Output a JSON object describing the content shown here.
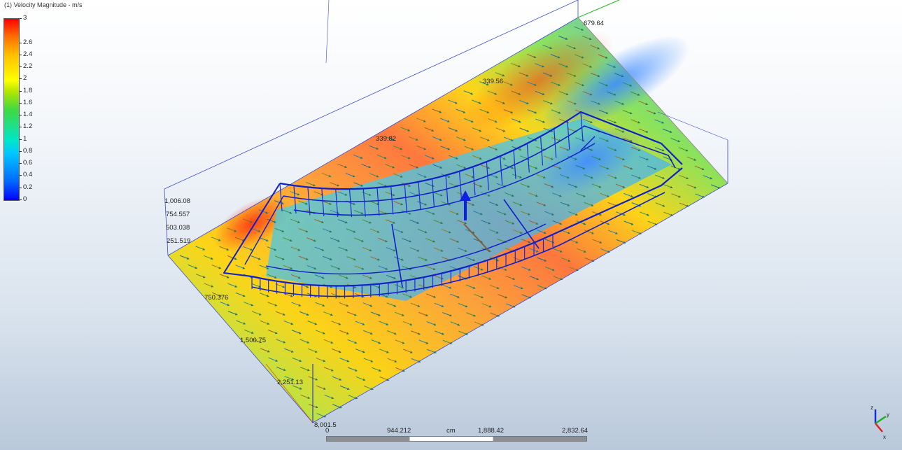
{
  "legend": {
    "title": "(1) Velocity Magnitude - m/s",
    "ticks": [
      {
        "label": "3",
        "value": 3
      },
      {
        "label": "2.6",
        "value": 2.6
      },
      {
        "label": "2.4",
        "value": 2.4
      },
      {
        "label": "2.2",
        "value": 2.2
      },
      {
        "label": "2",
        "value": 2
      },
      {
        "label": "1.8",
        "value": 1.8
      },
      {
        "label": "1.6",
        "value": 1.6
      },
      {
        "label": "1.4",
        "value": 1.4
      },
      {
        "label": "1.2",
        "value": 1.2
      },
      {
        "label": "1",
        "value": 1
      },
      {
        "label": "0.8",
        "value": 0.8
      },
      {
        "label": "0.6",
        "value": 0.6
      },
      {
        "label": "0.4",
        "value": 0.4
      },
      {
        "label": "0.2",
        "value": 0.2
      },
      {
        "label": "0",
        "value": 0
      }
    ],
    "colors": {
      "min": "#0000ff",
      "mid": "#40d940",
      "max": "#ff0000"
    }
  },
  "z_axis_labels": [
    "1,006.08",
    "754.557",
    "503.038",
    "251.519"
  ],
  "x_axis_labels": [
    "750.376",
    "1,500.75",
    "2,251.13"
  ],
  "other_labels": {
    "top_right": "679.64",
    "top_mid": "339.56",
    "center": "339.82",
    "origin": "8,001.5"
  },
  "scale_bar": {
    "labels": [
      "0",
      "944.212",
      "cm",
      "1,888.42",
      "2,832.64"
    ]
  },
  "triad": {
    "x": "x",
    "y": "y",
    "z": "z"
  },
  "colors": {
    "slow": "#1b3cff",
    "fast": "#e8231d",
    "box_edge": "#3a4bd8",
    "structure": "#1020c8"
  }
}
